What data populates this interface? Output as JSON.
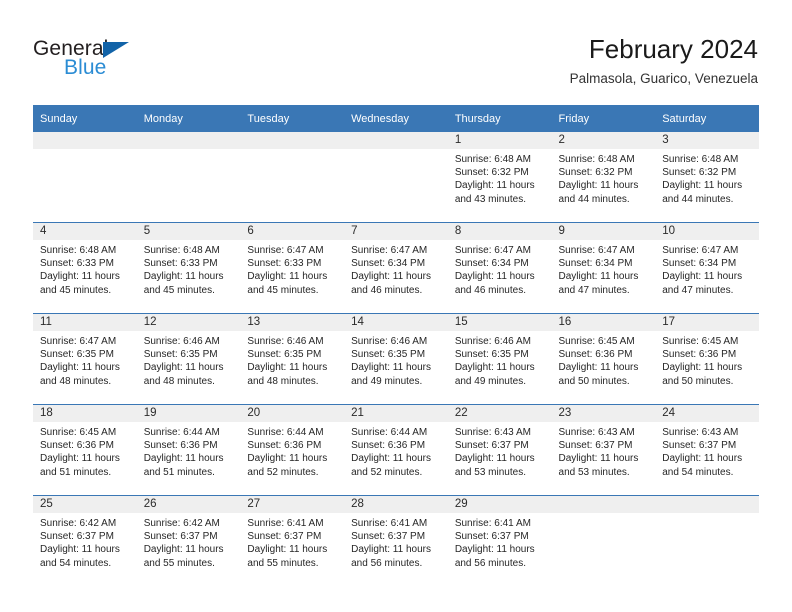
{
  "brand": {
    "word_general": "General",
    "word_blue": "Blue",
    "triangle_color": "#1263a8",
    "blue_color": "#2b8cd4"
  },
  "header": {
    "title": "February 2024",
    "subtitle": "Palmasola, Guarico, Venezuela",
    "header_bg": "#3a77b5",
    "daynum_bg": "#efefef"
  },
  "calendar": {
    "weekday_headers": [
      "Sunday",
      "Monday",
      "Tuesday",
      "Wednesday",
      "Thursday",
      "Friday",
      "Saturday"
    ],
    "weeks": [
      [
        {
          "day": "",
          "blank": true
        },
        {
          "day": "",
          "blank": true
        },
        {
          "day": "",
          "blank": true
        },
        {
          "day": "",
          "blank": true
        },
        {
          "day": "1",
          "sunrise": "Sunrise: 6:48 AM",
          "sunset": "Sunset: 6:32 PM",
          "daylight": "Daylight: 11 hours and 43 minutes."
        },
        {
          "day": "2",
          "sunrise": "Sunrise: 6:48 AM",
          "sunset": "Sunset: 6:32 PM",
          "daylight": "Daylight: 11 hours and 44 minutes."
        },
        {
          "day": "3",
          "sunrise": "Sunrise: 6:48 AM",
          "sunset": "Sunset: 6:32 PM",
          "daylight": "Daylight: 11 hours and 44 minutes."
        }
      ],
      [
        {
          "day": "4",
          "sunrise": "Sunrise: 6:48 AM",
          "sunset": "Sunset: 6:33 PM",
          "daylight": "Daylight: 11 hours and 45 minutes."
        },
        {
          "day": "5",
          "sunrise": "Sunrise: 6:48 AM",
          "sunset": "Sunset: 6:33 PM",
          "daylight": "Daylight: 11 hours and 45 minutes."
        },
        {
          "day": "6",
          "sunrise": "Sunrise: 6:47 AM",
          "sunset": "Sunset: 6:33 PM",
          "daylight": "Daylight: 11 hours and 45 minutes."
        },
        {
          "day": "7",
          "sunrise": "Sunrise: 6:47 AM",
          "sunset": "Sunset: 6:34 PM",
          "daylight": "Daylight: 11 hours and 46 minutes."
        },
        {
          "day": "8",
          "sunrise": "Sunrise: 6:47 AM",
          "sunset": "Sunset: 6:34 PM",
          "daylight": "Daylight: 11 hours and 46 minutes."
        },
        {
          "day": "9",
          "sunrise": "Sunrise: 6:47 AM",
          "sunset": "Sunset: 6:34 PM",
          "daylight": "Daylight: 11 hours and 47 minutes."
        },
        {
          "day": "10",
          "sunrise": "Sunrise: 6:47 AM",
          "sunset": "Sunset: 6:34 PM",
          "daylight": "Daylight: 11 hours and 47 minutes."
        }
      ],
      [
        {
          "day": "11",
          "sunrise": "Sunrise: 6:47 AM",
          "sunset": "Sunset: 6:35 PM",
          "daylight": "Daylight: 11 hours and 48 minutes."
        },
        {
          "day": "12",
          "sunrise": "Sunrise: 6:46 AM",
          "sunset": "Sunset: 6:35 PM",
          "daylight": "Daylight: 11 hours and 48 minutes."
        },
        {
          "day": "13",
          "sunrise": "Sunrise: 6:46 AM",
          "sunset": "Sunset: 6:35 PM",
          "daylight": "Daylight: 11 hours and 48 minutes."
        },
        {
          "day": "14",
          "sunrise": "Sunrise: 6:46 AM",
          "sunset": "Sunset: 6:35 PM",
          "daylight": "Daylight: 11 hours and 49 minutes."
        },
        {
          "day": "15",
          "sunrise": "Sunrise: 6:46 AM",
          "sunset": "Sunset: 6:35 PM",
          "daylight": "Daylight: 11 hours and 49 minutes."
        },
        {
          "day": "16",
          "sunrise": "Sunrise: 6:45 AM",
          "sunset": "Sunset: 6:36 PM",
          "daylight": "Daylight: 11 hours and 50 minutes."
        },
        {
          "day": "17",
          "sunrise": "Sunrise: 6:45 AM",
          "sunset": "Sunset: 6:36 PM",
          "daylight": "Daylight: 11 hours and 50 minutes."
        }
      ],
      [
        {
          "day": "18",
          "sunrise": "Sunrise: 6:45 AM",
          "sunset": "Sunset: 6:36 PM",
          "daylight": "Daylight: 11 hours and 51 minutes."
        },
        {
          "day": "19",
          "sunrise": "Sunrise: 6:44 AM",
          "sunset": "Sunset: 6:36 PM",
          "daylight": "Daylight: 11 hours and 51 minutes."
        },
        {
          "day": "20",
          "sunrise": "Sunrise: 6:44 AM",
          "sunset": "Sunset: 6:36 PM",
          "daylight": "Daylight: 11 hours and 52 minutes."
        },
        {
          "day": "21",
          "sunrise": "Sunrise: 6:44 AM",
          "sunset": "Sunset: 6:36 PM",
          "daylight": "Daylight: 11 hours and 52 minutes."
        },
        {
          "day": "22",
          "sunrise": "Sunrise: 6:43 AM",
          "sunset": "Sunset: 6:37 PM",
          "daylight": "Daylight: 11 hours and 53 minutes."
        },
        {
          "day": "23",
          "sunrise": "Sunrise: 6:43 AM",
          "sunset": "Sunset: 6:37 PM",
          "daylight": "Daylight: 11 hours and 53 minutes."
        },
        {
          "day": "24",
          "sunrise": "Sunrise: 6:43 AM",
          "sunset": "Sunset: 6:37 PM",
          "daylight": "Daylight: 11 hours and 54 minutes."
        }
      ],
      [
        {
          "day": "25",
          "sunrise": "Sunrise: 6:42 AM",
          "sunset": "Sunset: 6:37 PM",
          "daylight": "Daylight: 11 hours and 54 minutes."
        },
        {
          "day": "26",
          "sunrise": "Sunrise: 6:42 AM",
          "sunset": "Sunset: 6:37 PM",
          "daylight": "Daylight: 11 hours and 55 minutes."
        },
        {
          "day": "27",
          "sunrise": "Sunrise: 6:41 AM",
          "sunset": "Sunset: 6:37 PM",
          "daylight": "Daylight: 11 hours and 55 minutes."
        },
        {
          "day": "28",
          "sunrise": "Sunrise: 6:41 AM",
          "sunset": "Sunset: 6:37 PM",
          "daylight": "Daylight: 11 hours and 56 minutes."
        },
        {
          "day": "29",
          "sunrise": "Sunrise: 6:41 AM",
          "sunset": "Sunset: 6:37 PM",
          "daylight": "Daylight: 11 hours and 56 minutes."
        },
        {
          "day": "",
          "blank": true
        },
        {
          "day": "",
          "blank": true
        }
      ]
    ]
  }
}
